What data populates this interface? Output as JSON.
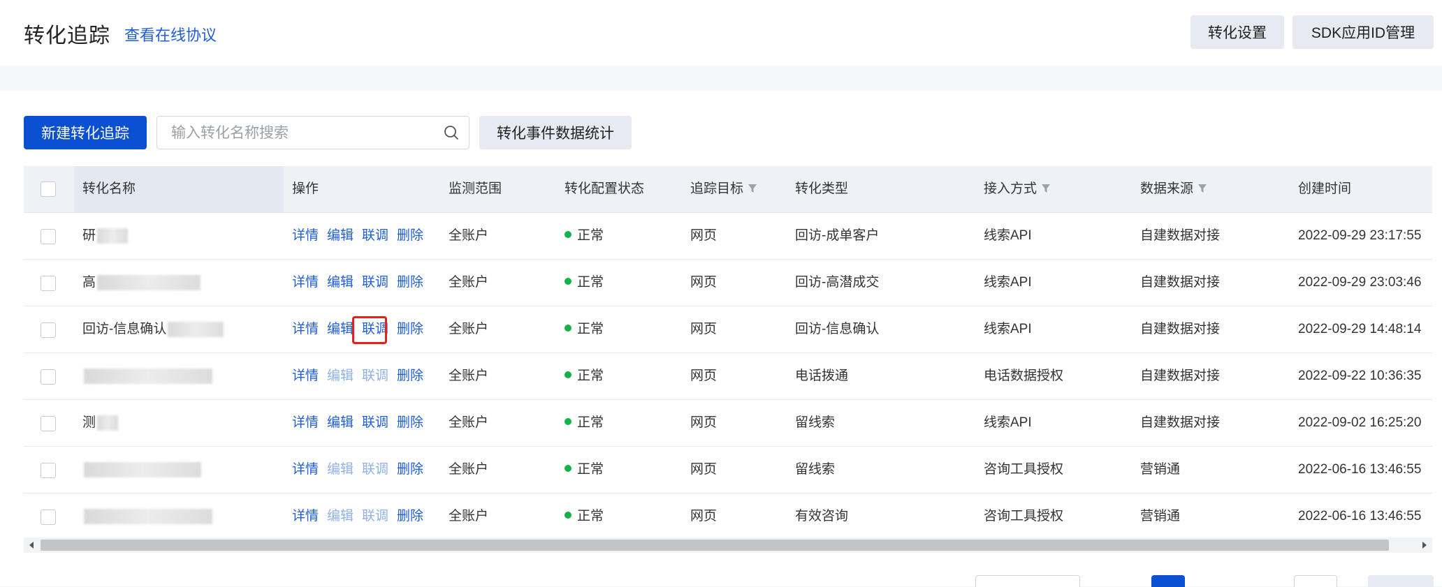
{
  "header": {
    "title": "转化追踪",
    "protocol_link": "查看在线协议",
    "buttons": [
      "转化设置",
      "SDK应用ID管理"
    ]
  },
  "toolbar": {
    "new_button": "新建转化追踪",
    "search_placeholder": "输入转化名称搜索",
    "stats_button": "转化事件数据统计"
  },
  "table": {
    "columns": [
      "转化名称",
      "操作",
      "监测范围",
      "转化配置状态",
      "追踪目标",
      "转化类型",
      "接入方式",
      "数据来源",
      "创建时间"
    ],
    "filterable_columns": [
      "追踪目标",
      "接入方式",
      "数据来源"
    ],
    "operations": [
      "详情",
      "编辑",
      "联调",
      "删除"
    ],
    "rows": [
      {
        "name": "研",
        "ops_enabled": [
          true,
          true,
          true,
          true
        ],
        "scope": "全账户",
        "status": "正常",
        "target": "网页",
        "type": "回访-成单客户",
        "access": "线索API",
        "source": "自建数据对接",
        "created": "2022-09-29 23:17:55"
      },
      {
        "name": "高",
        "ops_enabled": [
          true,
          true,
          true,
          true
        ],
        "scope": "全账户",
        "status": "正常",
        "target": "网页",
        "type": "回访-高潜成交",
        "access": "线索API",
        "source": "自建数据对接",
        "created": "2022-09-29 23:03:46"
      },
      {
        "name": "回访-信息确认",
        "ops_enabled": [
          true,
          true,
          true,
          true
        ],
        "scope": "全账户",
        "status": "正常",
        "target": "网页",
        "type": "回访-信息确认",
        "access": "线索API",
        "source": "自建数据对接",
        "created": "2022-09-29 14:48:14"
      },
      {
        "name": "",
        "ops_enabled": [
          true,
          false,
          false,
          true
        ],
        "scope": "全账户",
        "status": "正常",
        "target": "网页",
        "type": "电话拨通",
        "access": "电话数据授权",
        "source": "自建数据对接",
        "created": "2022-09-22 10:36:35"
      },
      {
        "name": "测",
        "ops_enabled": [
          true,
          true,
          true,
          true
        ],
        "scope": "全账户",
        "status": "正常",
        "target": "网页",
        "type": "留线索",
        "access": "线索API",
        "source": "自建数据对接",
        "created": "2022-09-02 16:25:20"
      },
      {
        "name": "",
        "ops_enabled": [
          true,
          false,
          false,
          true
        ],
        "scope": "全账户",
        "status": "正常",
        "target": "网页",
        "type": "留线索",
        "access": "咨询工具授权",
        "source": "营销通",
        "created": "2022-06-16 13:46:55"
      },
      {
        "name": "",
        "ops_enabled": [
          true,
          false,
          false,
          true
        ],
        "scope": "全账户",
        "status": "正常",
        "target": "网页",
        "type": "有效咨询",
        "access": "咨询工具授权",
        "source": "营销通",
        "created": "2022-06-16 13:46:55"
      }
    ]
  },
  "colors": {
    "primary": "#0b50d0",
    "link": "#1f5ed6",
    "status_ok": "#12b347",
    "highlight": "#e5211c"
  }
}
